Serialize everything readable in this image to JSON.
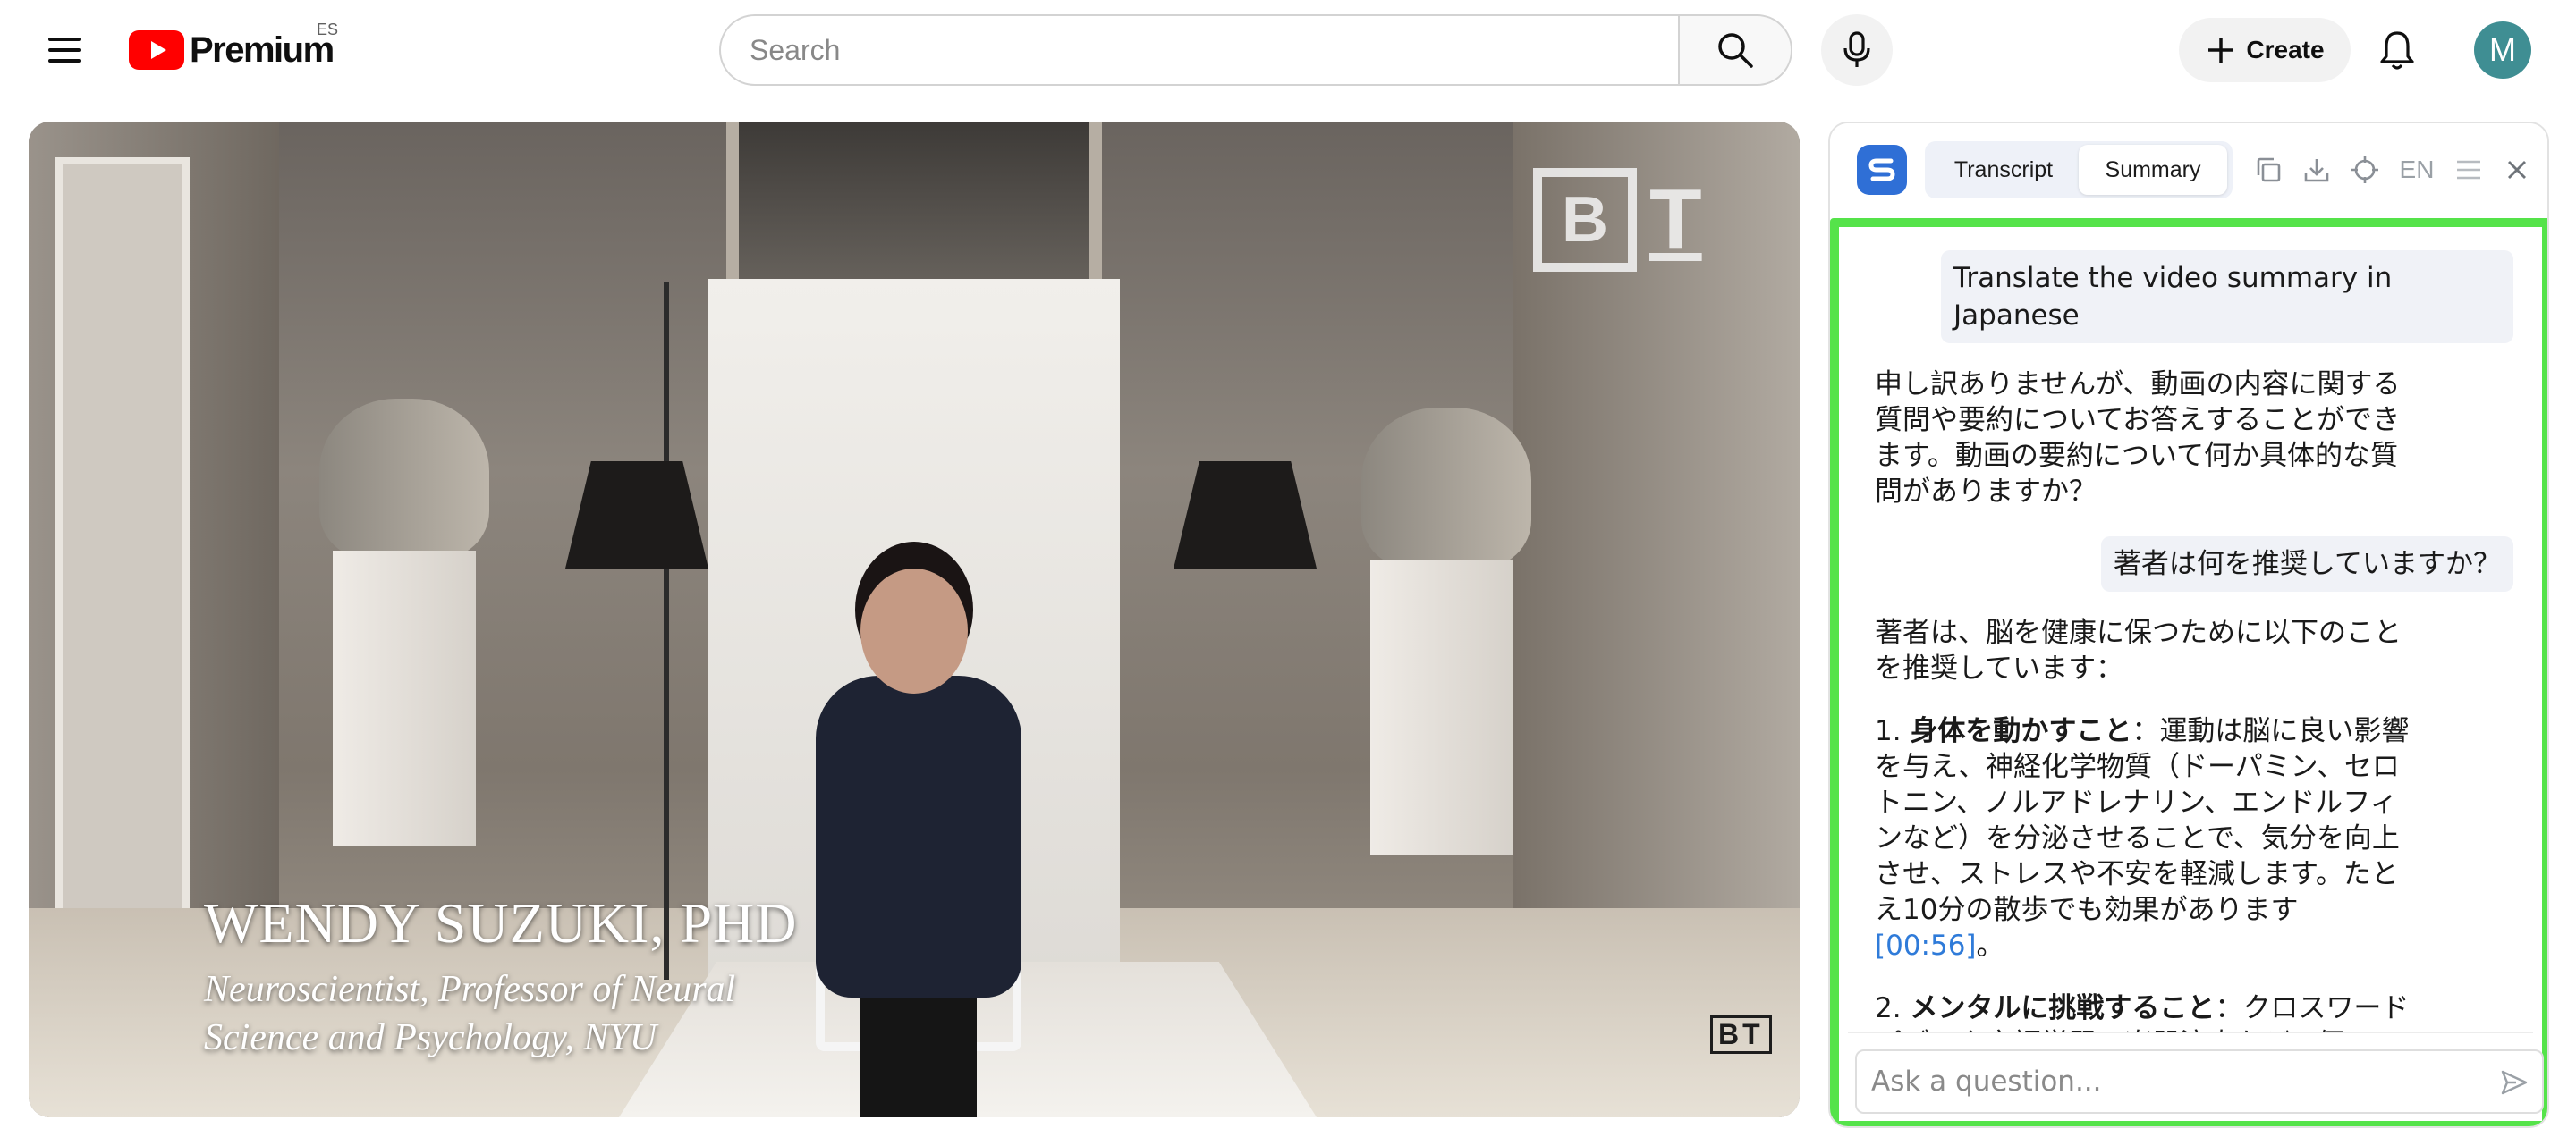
{
  "header": {
    "logo_text": "Premium",
    "region_code": "ES",
    "search_placeholder": "Search",
    "create_label": "Create",
    "avatar_initial": "M",
    "icons": {
      "menu": "hamburger-icon",
      "logo": "youtube-play-icon",
      "search": "search-icon",
      "mic": "microphone-icon",
      "create": "plus-icon",
      "notifications": "bell-icon"
    }
  },
  "video": {
    "name_caption": "WENDY SUZUKI, PHD",
    "role_caption": "Neuroscientist, Professor of Neural\nScience and Psychology, NYU",
    "watermark_b": "B",
    "watermark_t": "T",
    "watermark_small": "BT"
  },
  "panel": {
    "tabs": [
      {
        "label": "Transcript"
      },
      {
        "label": "Summary"
      }
    ],
    "active_tab": "Summary",
    "language": "EN",
    "icons": [
      "extension-logo-icon",
      "copy-icon",
      "download-icon",
      "crosshair-icon",
      "menu-lines-icon",
      "close-icon",
      "send-icon"
    ],
    "messages": [
      {
        "role": "user",
        "text": "Translate the video summary in Japanese"
      },
      {
        "role": "ai",
        "text": "申し訳ありませんが、動画の内容に関する質問や要約についてお答えすることができます。動画の要約について何か具体的な質問がありますか？"
      },
      {
        "role": "user",
        "text": "著者は何を推奨していますか？"
      },
      {
        "role": "ai",
        "intro": "著者は、脳を健康に保つために以下のことを推奨しています：",
        "items": [
          {
            "num": "1.",
            "title": "身体を動かすこと",
            "sep": "：",
            "body": "運動は脳に良い影響を与え、神経化学物質（ドーパミン、セロトニン、ノルアドレナリン、エンドルフィンなど）を分泌させることで、気分を向上させ、ストレスや不安を軽減します。たとえ10分の散歩でも効果があります",
            "timestamp": "[00:56]",
            "end": "。"
          },
          {
            "num": "2.",
            "title": "メンタルに挑戦すること",
            "sep": "：",
            "body": "クロスワードパズルや言語学習、楽器演奏など、個"
          }
        ]
      }
    ],
    "ask_placeholder": "Ask a question...",
    "accent_color": "#55e34a",
    "brand_color": "#2f6fd6"
  }
}
